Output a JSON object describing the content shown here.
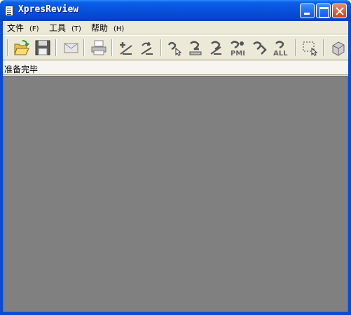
{
  "window": {
    "title": "XpresReview",
    "colors": {
      "titlebar": "#0753dd",
      "workspace": "#808080",
      "chrome": "#ece9d8"
    }
  },
  "menu": {
    "items": [
      {
        "label": "文件",
        "accel": "(F)"
      },
      {
        "label": "工具",
        "accel": "(T)"
      },
      {
        "label": "帮助",
        "accel": "(H)"
      }
    ]
  },
  "toolbar": {
    "icons": [
      "open-folder-icon",
      "save-disk-icon",
      "email-envelope-icon",
      "print-icon",
      "add-markup-icon",
      "swap-markup-icon",
      "markup-select-icon",
      "markup-erase-icon",
      "markup-check-icon",
      "markup-pmi-icon",
      "markup-next-icon",
      "markup-all-icon",
      "selection-box-icon",
      "3d-box-icon"
    ],
    "pmi_label": "PMI",
    "all_label": "ALL"
  },
  "status": {
    "text": "准备完毕"
  }
}
